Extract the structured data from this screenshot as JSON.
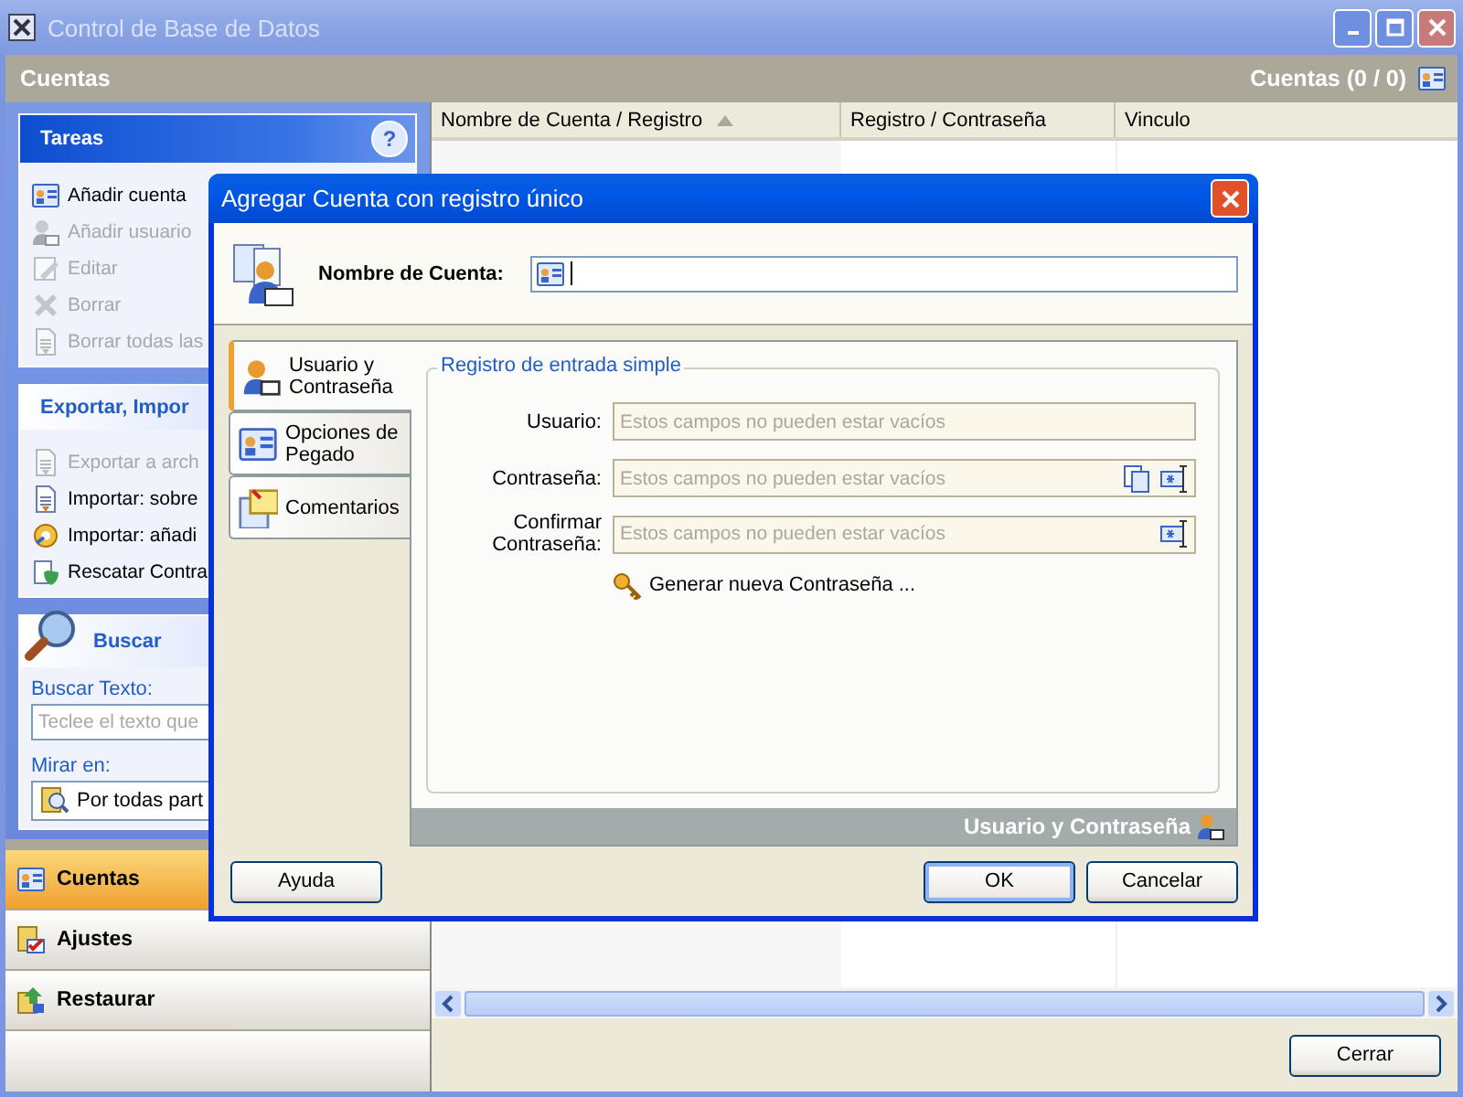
{
  "window": {
    "title": "Control de Base de Datos"
  },
  "header": {
    "title": "Cuentas",
    "count": "Cuentas (0 / 0)"
  },
  "sidebar": {
    "panes": [
      {
        "kind": "tasks",
        "title": "Tareas",
        "help_button": "?",
        "items": [
          {
            "label": "Añadir cuenta",
            "disabled": false
          },
          {
            "label": "Añadir usuario",
            "disabled": true
          },
          {
            "label": "Editar",
            "disabled": true
          },
          {
            "label": "Borrar",
            "disabled": true
          },
          {
            "label": "Borrar todas las",
            "disabled": true
          }
        ]
      },
      {
        "kind": "tasks",
        "title": "Exportar, Impor",
        "items": [
          {
            "label": "Exportar a arch",
            "disabled": true
          },
          {
            "label": "Importar: sobre",
            "disabled": false
          },
          {
            "label": "Importar: añadi",
            "disabled": false
          },
          {
            "label": "Rescatar Contra",
            "disabled": false
          }
        ]
      },
      {
        "kind": "search",
        "title": "Buscar",
        "search_label": "Buscar Texto:",
        "search_placeholder": "Teclee el texto que",
        "look_label": "Mirar en:",
        "look_value": "Por todas part"
      }
    ],
    "nav": [
      {
        "label": "Cuentas",
        "selected": true
      },
      {
        "label": "Ajustes",
        "selected": false
      },
      {
        "label": "Restaurar",
        "selected": false
      }
    ]
  },
  "table": {
    "columns": [
      {
        "label": "Nombre de Cuenta / Registro",
        "sorted": true
      },
      {
        "label": "Registro / Contraseña",
        "sorted": false
      },
      {
        "label": "Vinculo",
        "sorted": false
      }
    ]
  },
  "close_button": "Cerrar",
  "dialog": {
    "title": "Agregar Cuenta con registro único",
    "name_label": "Nombre de Cuenta:",
    "tabs": [
      {
        "label": "Usuario y Contraseña",
        "selected": true
      },
      {
        "label": "Opciones de Pegado",
        "selected": false
      },
      {
        "label": "Comentarios",
        "selected": false
      }
    ],
    "group_title": "Registro de entrada simple",
    "fields": [
      {
        "kind": "text",
        "label": "Usuario:",
        "placeholder": "Estos campos no pueden estar vacíos"
      },
      {
        "kind": "password",
        "label": "Contraseña:",
        "placeholder": "Estos campos no pueden estar vacíos"
      },
      {
        "kind": "confirm",
        "label": "Confirmar Contraseña:",
        "placeholder": "Estos campos no pueden estar vacíos"
      }
    ],
    "generate_link": "Generar nueva Contraseña ...",
    "panel_footer": "Usuario y Contraseña",
    "help_button": "Ayuda",
    "ok_button": "OK",
    "cancel_button": "Cancelar"
  }
}
